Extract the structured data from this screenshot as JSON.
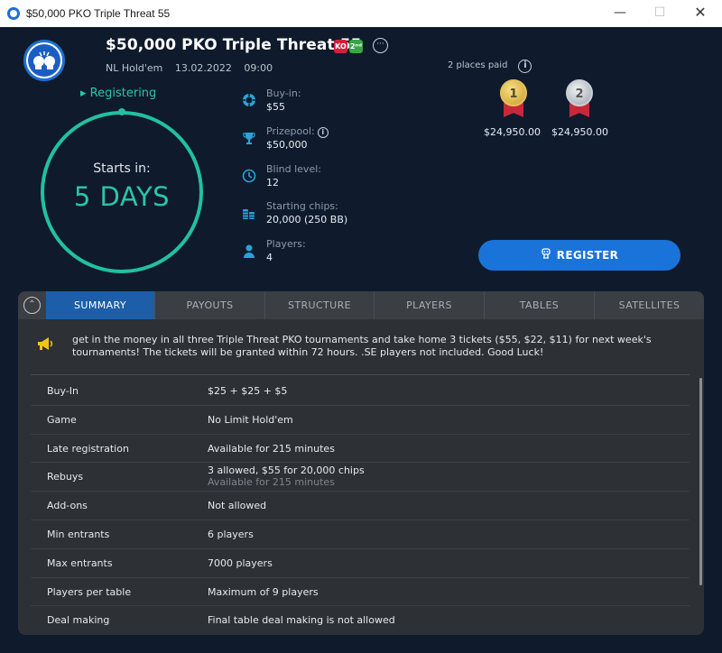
{
  "window": {
    "title": "$50,000 PKO Triple Threat 55",
    "minimize_glyph": "—",
    "maximize_glyph": "☐",
    "close_glyph": "✕"
  },
  "header": {
    "title": "$50,000 PKO Triple Threat 55",
    "badge_ko": "KO",
    "badge_se": "2ⁿᵈ",
    "more_glyph": "···",
    "game_type": "NL Hold'em",
    "date": "13.02.2022",
    "time": "09:00"
  },
  "status": {
    "registering": "Registering",
    "starts_in_label": "Starts in:",
    "starts_in_value": "5 DAYS"
  },
  "stats": [
    {
      "icon": "poker-chip-icon",
      "label": "Buy-in:",
      "value": "$55"
    },
    {
      "icon": "trophy-icon",
      "label": "Prizepool:",
      "value": "$50,000"
    },
    {
      "icon": "clock-icon",
      "label": "Blind level:",
      "value": "12"
    },
    {
      "icon": "chip-stack-icon",
      "label": "Starting chips:",
      "value": "20,000 (250 BB)"
    },
    {
      "icon": "user-icon",
      "label": "Players:",
      "value": "4"
    }
  ],
  "payouts": {
    "places_paid": "2 places paid",
    "first_place": "1",
    "second_place": "2",
    "first_amount": "$24,950.00",
    "second_amount": "$24,950.00"
  },
  "register_label": "REGISTER",
  "tabs": [
    "SUMMARY",
    "PAYOUTS",
    "STRUCTURE",
    "PLAYERS",
    "TABLES",
    "SATELLITES"
  ],
  "announcement": "get in the money in all three Triple Threat PKO tournaments and take home 3 tickets ($55, $22, $11) for next week's tournaments! The tickets will be granted within 72 hours. .SE players not included. Good Luck!",
  "details": [
    {
      "key": "Buy-In",
      "value": "$25 + $25 + $5"
    },
    {
      "key": "Game",
      "value": "No Limit Hold'em"
    },
    {
      "key": "Late registration",
      "value": "Available for 215 minutes"
    },
    {
      "key": "Rebuys",
      "value": "3 allowed, $55 for 20,000 chips",
      "sub": "Available for 215 minutes"
    },
    {
      "key": "Add-ons",
      "value": "Not allowed"
    },
    {
      "key": "Min entrants",
      "value": "6 players"
    },
    {
      "key": "Max entrants",
      "value": "7000 players"
    },
    {
      "key": "Players per table",
      "value": "Maximum of 9 players"
    },
    {
      "key": "Deal making",
      "value": "Final table deal making is not allowed"
    }
  ],
  "colors": {
    "background": "#0f1b2c",
    "accent_teal": "#21c1a1",
    "button_blue": "#1a73d9",
    "active_tab": "#1c5ea8",
    "panel": "#2d3035"
  }
}
